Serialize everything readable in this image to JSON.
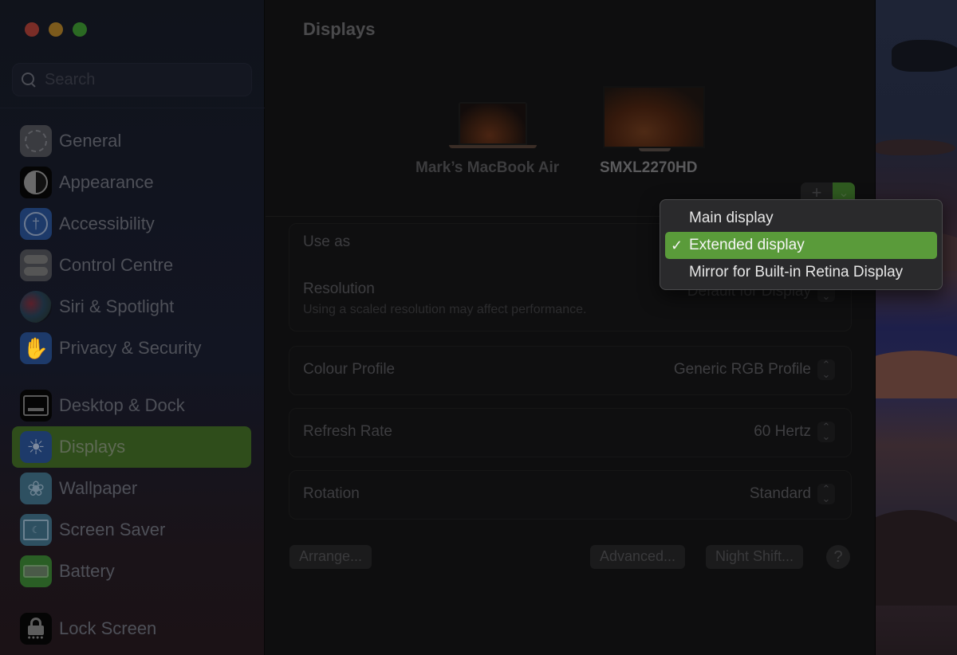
{
  "window": {
    "controls": [
      "close",
      "minimize",
      "maximize"
    ]
  },
  "sidebar": {
    "search_placeholder": "Search",
    "items": [
      {
        "label": "General",
        "icon": "gear-icon"
      },
      {
        "label": "Appearance",
        "icon": "appearance-icon"
      },
      {
        "label": "Accessibility",
        "icon": "accessibility-icon"
      },
      {
        "label": "Control Centre",
        "icon": "control-centre-icon"
      },
      {
        "label": "Siri & Spotlight",
        "icon": "siri-icon"
      },
      {
        "label": "Privacy & Security",
        "icon": "hand-icon"
      },
      {
        "label": "Desktop & Dock",
        "icon": "desktop-dock-icon"
      },
      {
        "label": "Displays",
        "icon": "sun-icon",
        "active": true
      },
      {
        "label": "Wallpaper",
        "icon": "flower-icon"
      },
      {
        "label": "Screen Saver",
        "icon": "screen-saver-icon"
      },
      {
        "label": "Battery",
        "icon": "battery-icon"
      },
      {
        "label": "Lock Screen",
        "icon": "lock-icon"
      }
    ]
  },
  "main": {
    "title": "Displays",
    "displays": [
      {
        "name": "Mark’s MacBook Air",
        "selected": false
      },
      {
        "name": "SMXL2270HD",
        "selected": true
      }
    ],
    "add_button": "+",
    "remove_button": "⌄",
    "settings": {
      "use_as_label": "Use as",
      "resolution_label": "Resolution",
      "resolution_note": "Using a scaled resolution may affect performance.",
      "resolution_value": "Default for Display",
      "colour_profile_label": "Colour Profile",
      "colour_profile_value": "Generic RGB Profile",
      "refresh_rate_label": "Refresh Rate",
      "refresh_rate_value": "60 Hertz",
      "rotation_label": "Rotation",
      "rotation_value": "Standard"
    },
    "buttons": {
      "arrange": "Arrange...",
      "advanced": "Advanced...",
      "night_shift": "Night Shift...",
      "help": "?"
    }
  },
  "popup": {
    "items": [
      {
        "label": "Main display",
        "checked": false
      },
      {
        "label": "Extended display",
        "checked": true
      },
      {
        "label": "Mirror for Built-in Retina Display",
        "checked": false
      }
    ],
    "check_glyph": "✓"
  },
  "colors": {
    "accent": "#5a9b3a",
    "sidebar_active": "#2f4d1b"
  }
}
